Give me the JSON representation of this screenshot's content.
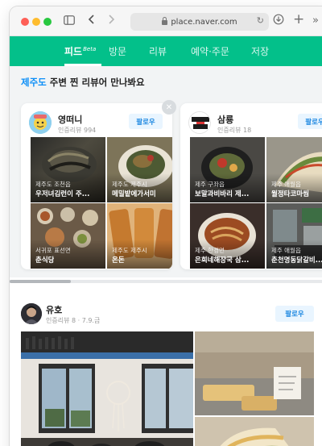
{
  "browser": {
    "url": "place.naver.com",
    "icons": [
      "sidebar-icon",
      "back-icon",
      "forward-icon",
      "lock-icon",
      "reload-icon",
      "download-icon",
      "new-tab-icon",
      "more-icon"
    ]
  },
  "nav": {
    "tabs": [
      {
        "label": "피드",
        "badge": "Beta",
        "active": true
      },
      {
        "label": "방문"
      },
      {
        "label": "리뷰"
      },
      {
        "label": "예약·주문"
      },
      {
        "label": "저장"
      }
    ]
  },
  "recommend": {
    "title_highlight": "제주도",
    "title_rest": " 주변 찐 리뷰어 만나봐요",
    "reviewers": [
      {
        "name": "영떠니",
        "sub": "인증리뷰 994",
        "follow": "팔로우",
        "tiles": [
          {
            "area": "제주도 조천읍",
            "place": "우저녀김런이 주..."
          },
          {
            "area": "제주도 제주시",
            "place": "메밀밭에가서미"
          },
          {
            "area": "서귀포 표선면",
            "place": "춘식당"
          },
          {
            "area": "제주도 제주시",
            "place": "온돈"
          }
        ]
      },
      {
        "name": "삼룡",
        "sub": "인증리뷰 18",
        "follow": "팔로우",
        "tiles": [
          {
            "area": "제주 구좌읍",
            "place": "보말과비바리 제..."
          },
          {
            "area": "제주 애월읍",
            "place": "월정타코마씸"
          },
          {
            "area": "제주 한경면",
            "place": "은희네해장국 삼..."
          },
          {
            "area": "제주 애월읍",
            "place": "춘천명동닭갈비..."
          }
        ]
      }
    ]
  },
  "post": {
    "name": "유호",
    "sub": "인증리뷰 8 · 7.9.금",
    "follow": "팔로우"
  },
  "colors": {
    "brand_green": "#03c08a",
    "link_blue": "#0b8ef7",
    "follow_bg": "#e9f5ff",
    "follow_text": "#1a86e0"
  }
}
